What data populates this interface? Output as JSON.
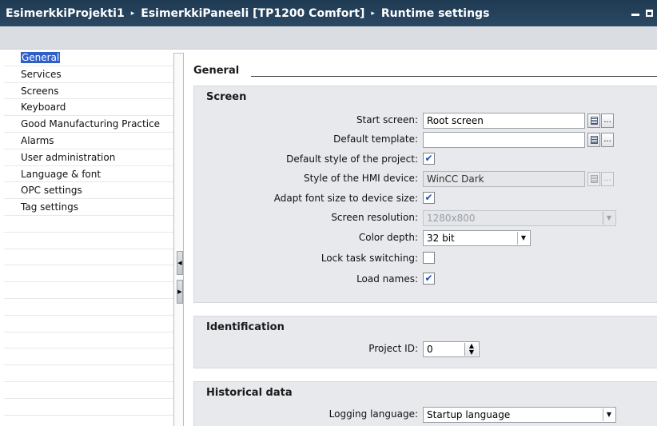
{
  "titlebar": {
    "crumbs": [
      "EsimerkkiProjekti1",
      "EsimerkkiPaneeli [TP1200 Comfort]",
      "Runtime settings"
    ],
    "separator": "▸"
  },
  "nav": {
    "items": [
      {
        "label": "General",
        "selected": true
      },
      {
        "label": "Services"
      },
      {
        "label": "Screens"
      },
      {
        "label": "Keyboard"
      },
      {
        "label": "Good Manufacturing Practice"
      },
      {
        "label": "Alarms"
      },
      {
        "label": "User administration"
      },
      {
        "label": "Language & font"
      },
      {
        "label": "OPC settings"
      },
      {
        "label": "Tag settings"
      }
    ]
  },
  "main": {
    "heading": "General",
    "screen": {
      "title": "Screen",
      "start_screen_label": "Start screen:",
      "start_screen_value": "Root screen",
      "default_template_label": "Default template:",
      "default_template_value": "",
      "default_style_label": "Default style of the project:",
      "default_style_checked": true,
      "hmi_style_label": "Style of the HMI device:",
      "hmi_style_value": "WinCC Dark",
      "adapt_font_label": "Adapt font size to device size:",
      "adapt_font_checked": true,
      "resolution_label": "Screen resolution:",
      "resolution_value": "1280x800",
      "color_depth_label": "Color depth:",
      "color_depth_value": "32 bit",
      "lock_task_label": "Lock task switching:",
      "lock_task_checked": false,
      "load_names_label": "Load names:",
      "load_names_checked": true
    },
    "identification": {
      "title": "Identification",
      "project_id_label": "Project ID:",
      "project_id_value": "0"
    },
    "historical": {
      "title": "Historical data",
      "logging_language_label": "Logging language:",
      "logging_language_value": "Startup language"
    }
  },
  "buttons": {
    "ellipsis": "...",
    "check": "✔",
    "dropdown": "▼",
    "spin": "▲▼"
  }
}
